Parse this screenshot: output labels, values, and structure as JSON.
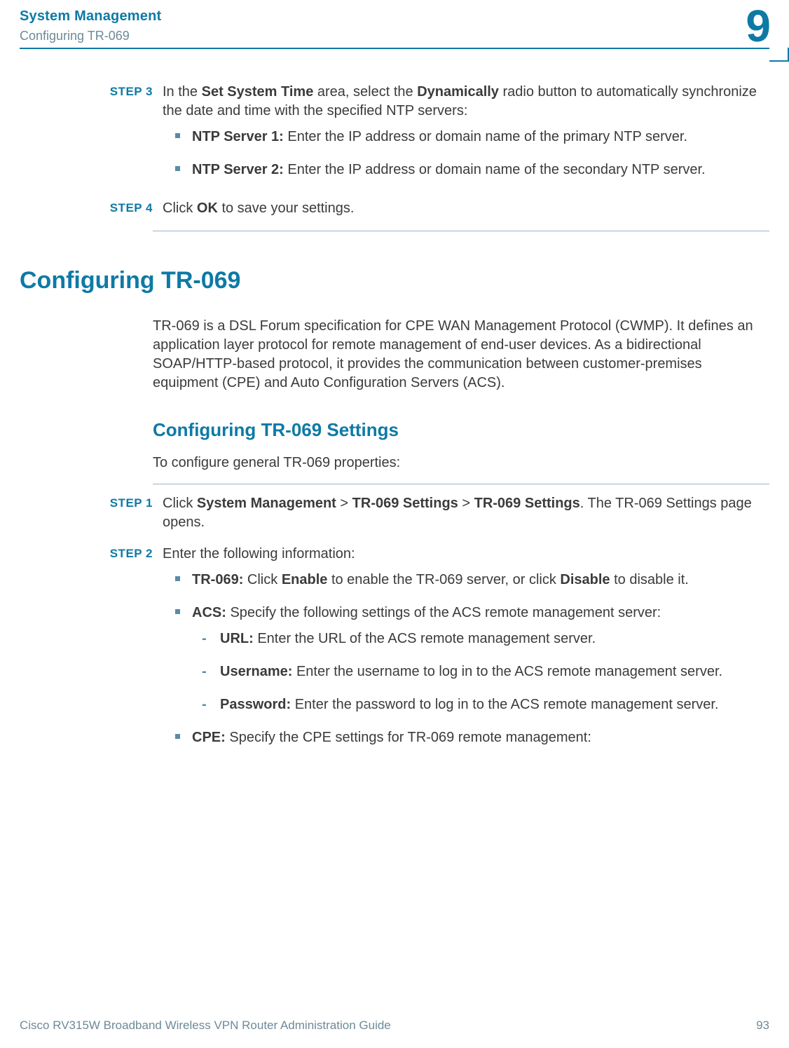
{
  "header": {
    "title": "System Management",
    "subtitle": "Configuring TR-069",
    "chapter": "9"
  },
  "step3": {
    "label": "STEP  3",
    "text_pre": "In the ",
    "bold1": "Set System Time",
    "text_mid1": " area, select the ",
    "bold2": "Dynamically",
    "text_post": " radio button to automatically synchronize the date and time with the specified NTP servers:",
    "ntp1_label": "NTP Server 1:",
    "ntp1_text": " Enter the IP address or domain name of the primary NTP server.",
    "ntp2_label": "NTP Server 2:",
    "ntp2_text": " Enter the IP address or domain name of the secondary NTP server."
  },
  "step4": {
    "label": "STEP  4",
    "text_pre": "Click ",
    "bold": "OK",
    "text_post": " to save your settings."
  },
  "section": {
    "h1": "Configuring TR-069",
    "intro": "TR-069 is a DSL Forum specification for CPE WAN Management Protocol (CWMP). It defines an application layer protocol for remote management of end-user devices. As a bidirectional SOAP/HTTP-based protocol, it provides the communication between customer-premises equipment (CPE) and Auto Configuration Servers (ACS).",
    "h2": "Configuring TR-069 Settings",
    "h2_intro": "To configure general TR-069 properties:"
  },
  "step1": {
    "label": "STEP  1",
    "pre": "Click ",
    "b1": "System Management",
    "gt1": " > ",
    "b2": "TR-069 Settings",
    "gt2": " > ",
    "b3": "TR-069 Settings",
    "post": ". The TR-069 Settings page opens."
  },
  "step2": {
    "label": "STEP  2",
    "intro": "Enter the following information:",
    "tr069_label": "TR-069:",
    "tr069_pre": " Click ",
    "tr069_b1": "Enable",
    "tr069_mid": " to enable the TR-069 server, or click ",
    "tr069_b2": "Disable",
    "tr069_post": " to disable it.",
    "acs_label": "ACS:",
    "acs_text": " Specify the following settings of the ACS remote management server:",
    "url_label": "URL:",
    "url_text": " Enter the URL of the ACS remote management server.",
    "user_label": "Username:",
    "user_text": " Enter the username to log in to the ACS remote management server.",
    "pass_label": "Password:",
    "pass_text": " Enter the password to log in to the ACS remote management server.",
    "cpe_label": "CPE:",
    "cpe_text": " Specify the CPE settings for TR-069 remote management:"
  },
  "footer": {
    "left": "Cisco RV315W Broadband Wireless VPN Router Administration Guide",
    "right": "93"
  },
  "dash": "-"
}
